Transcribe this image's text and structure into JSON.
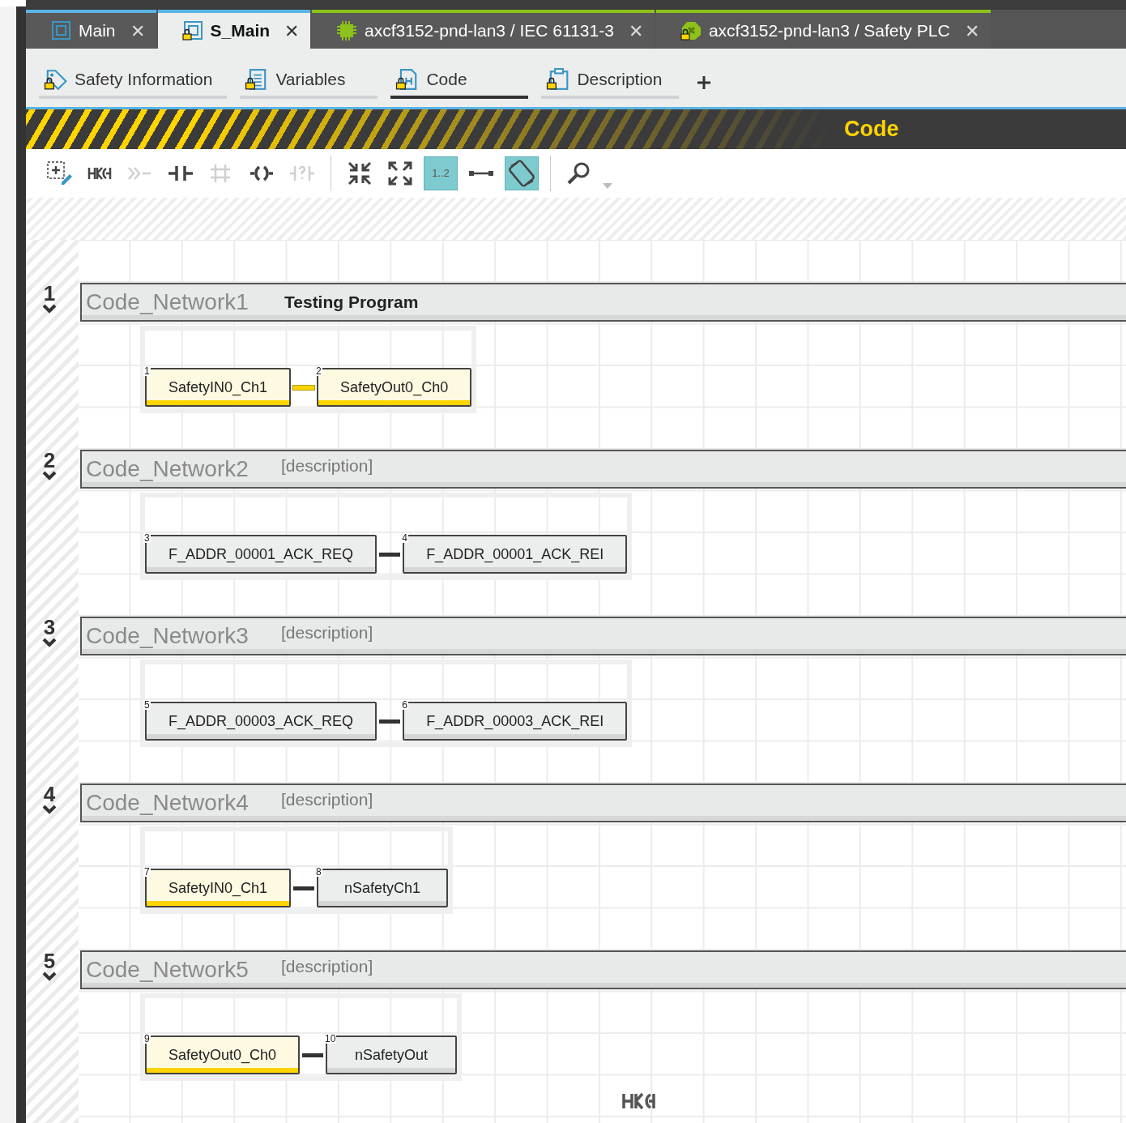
{
  "tabs": [
    {
      "label": "Main",
      "close": "✕",
      "kind": "window",
      "locked": false,
      "color": "#5ab4e6",
      "selected": false
    },
    {
      "label": "S_Main",
      "close": "✕",
      "kind": "window",
      "locked": true,
      "color": "#5ab4e6",
      "selected": true
    },
    {
      "label": "axcf3152-pnd-lan3 / IEC 61131-3",
      "close": "✕",
      "kind": "chip",
      "locked": false,
      "color": "#8cc21a",
      "selected": false
    },
    {
      "label": "axcf3152-pnd-lan3 / Safety PLC",
      "close": "✕",
      "kind": "plc",
      "locked": true,
      "color": "#8cc21a",
      "selected": false
    }
  ],
  "subtabs": [
    {
      "label": "Safety Information",
      "kind": "tag",
      "selected": false
    },
    {
      "label": "Variables",
      "kind": "list",
      "selected": false
    },
    {
      "label": "Code",
      "kind": "code",
      "selected": true
    },
    {
      "label": "Description",
      "kind": "clipboard",
      "selected": false
    }
  ],
  "banner": {
    "title": "Code"
  },
  "toolbar": [
    {
      "kind": "add",
      "active": false,
      "disabled": false
    },
    {
      "kind": "block",
      "active": false,
      "disabled": false
    },
    {
      "kind": "jump",
      "active": false,
      "disabled": true
    },
    {
      "kind": "contact",
      "active": false,
      "disabled": false
    },
    {
      "kind": "branch",
      "active": false,
      "disabled": true
    },
    {
      "kind": "coil",
      "active": false,
      "disabled": false
    },
    {
      "kind": "negated",
      "active": false,
      "disabled": true
    },
    {
      "kind": "sep"
    },
    {
      "kind": "collapse",
      "active": false,
      "disabled": false
    },
    {
      "kind": "expand",
      "active": false,
      "disabled": false
    },
    {
      "kind": "numbering",
      "label": "1..2",
      "active": true,
      "disabled": false
    },
    {
      "kind": "connect",
      "active": false,
      "disabled": false
    },
    {
      "kind": "wrap",
      "active": true,
      "disabled": false
    },
    {
      "kind": "sep"
    },
    {
      "kind": "search",
      "active": false,
      "disabled": false
    }
  ],
  "networks": [
    {
      "number": "1",
      "name": "Code_Network1",
      "comment": "Testing Program",
      "contacts": [
        {
          "index": "1",
          "label": "SafetyIN0_Ch1",
          "kind": "safety"
        },
        {
          "index": "2",
          "label": "SafetyOut0_Ch0",
          "kind": "safety"
        }
      ]
    },
    {
      "number": "2",
      "name": "Code_Network2",
      "placeholder": "[description]",
      "contacts": [
        {
          "index": "3",
          "label": "F_ADDR_00001_ACK_REQ",
          "kind": "standard"
        },
        {
          "index": "4",
          "label": "F_ADDR_00001_ACK_REI",
          "kind": "standard"
        }
      ]
    },
    {
      "number": "3",
      "name": "Code_Network3",
      "placeholder": "[description]",
      "contacts": [
        {
          "index": "5",
          "label": "F_ADDR_00003_ACK_REQ",
          "kind": "standard"
        },
        {
          "index": "6",
          "label": "F_ADDR_00003_ACK_REI",
          "kind": "standard"
        }
      ]
    },
    {
      "number": "4",
      "name": "Code_Network4",
      "placeholder": "[description]",
      "contacts": [
        {
          "index": "7",
          "label": "SafetyIN0_Ch1",
          "kind": "safety"
        },
        {
          "index": "8",
          "label": "nSafetyCh1",
          "kind": "standard"
        }
      ]
    },
    {
      "number": "5",
      "name": "Code_Network5",
      "placeholder": "[description]",
      "contacts": [
        {
          "index": "9",
          "label": "SafetyOut0_Ch0",
          "kind": "safety"
        },
        {
          "index": "10",
          "label": "nSafetyOut",
          "kind": "standard"
        }
      ]
    }
  ]
}
